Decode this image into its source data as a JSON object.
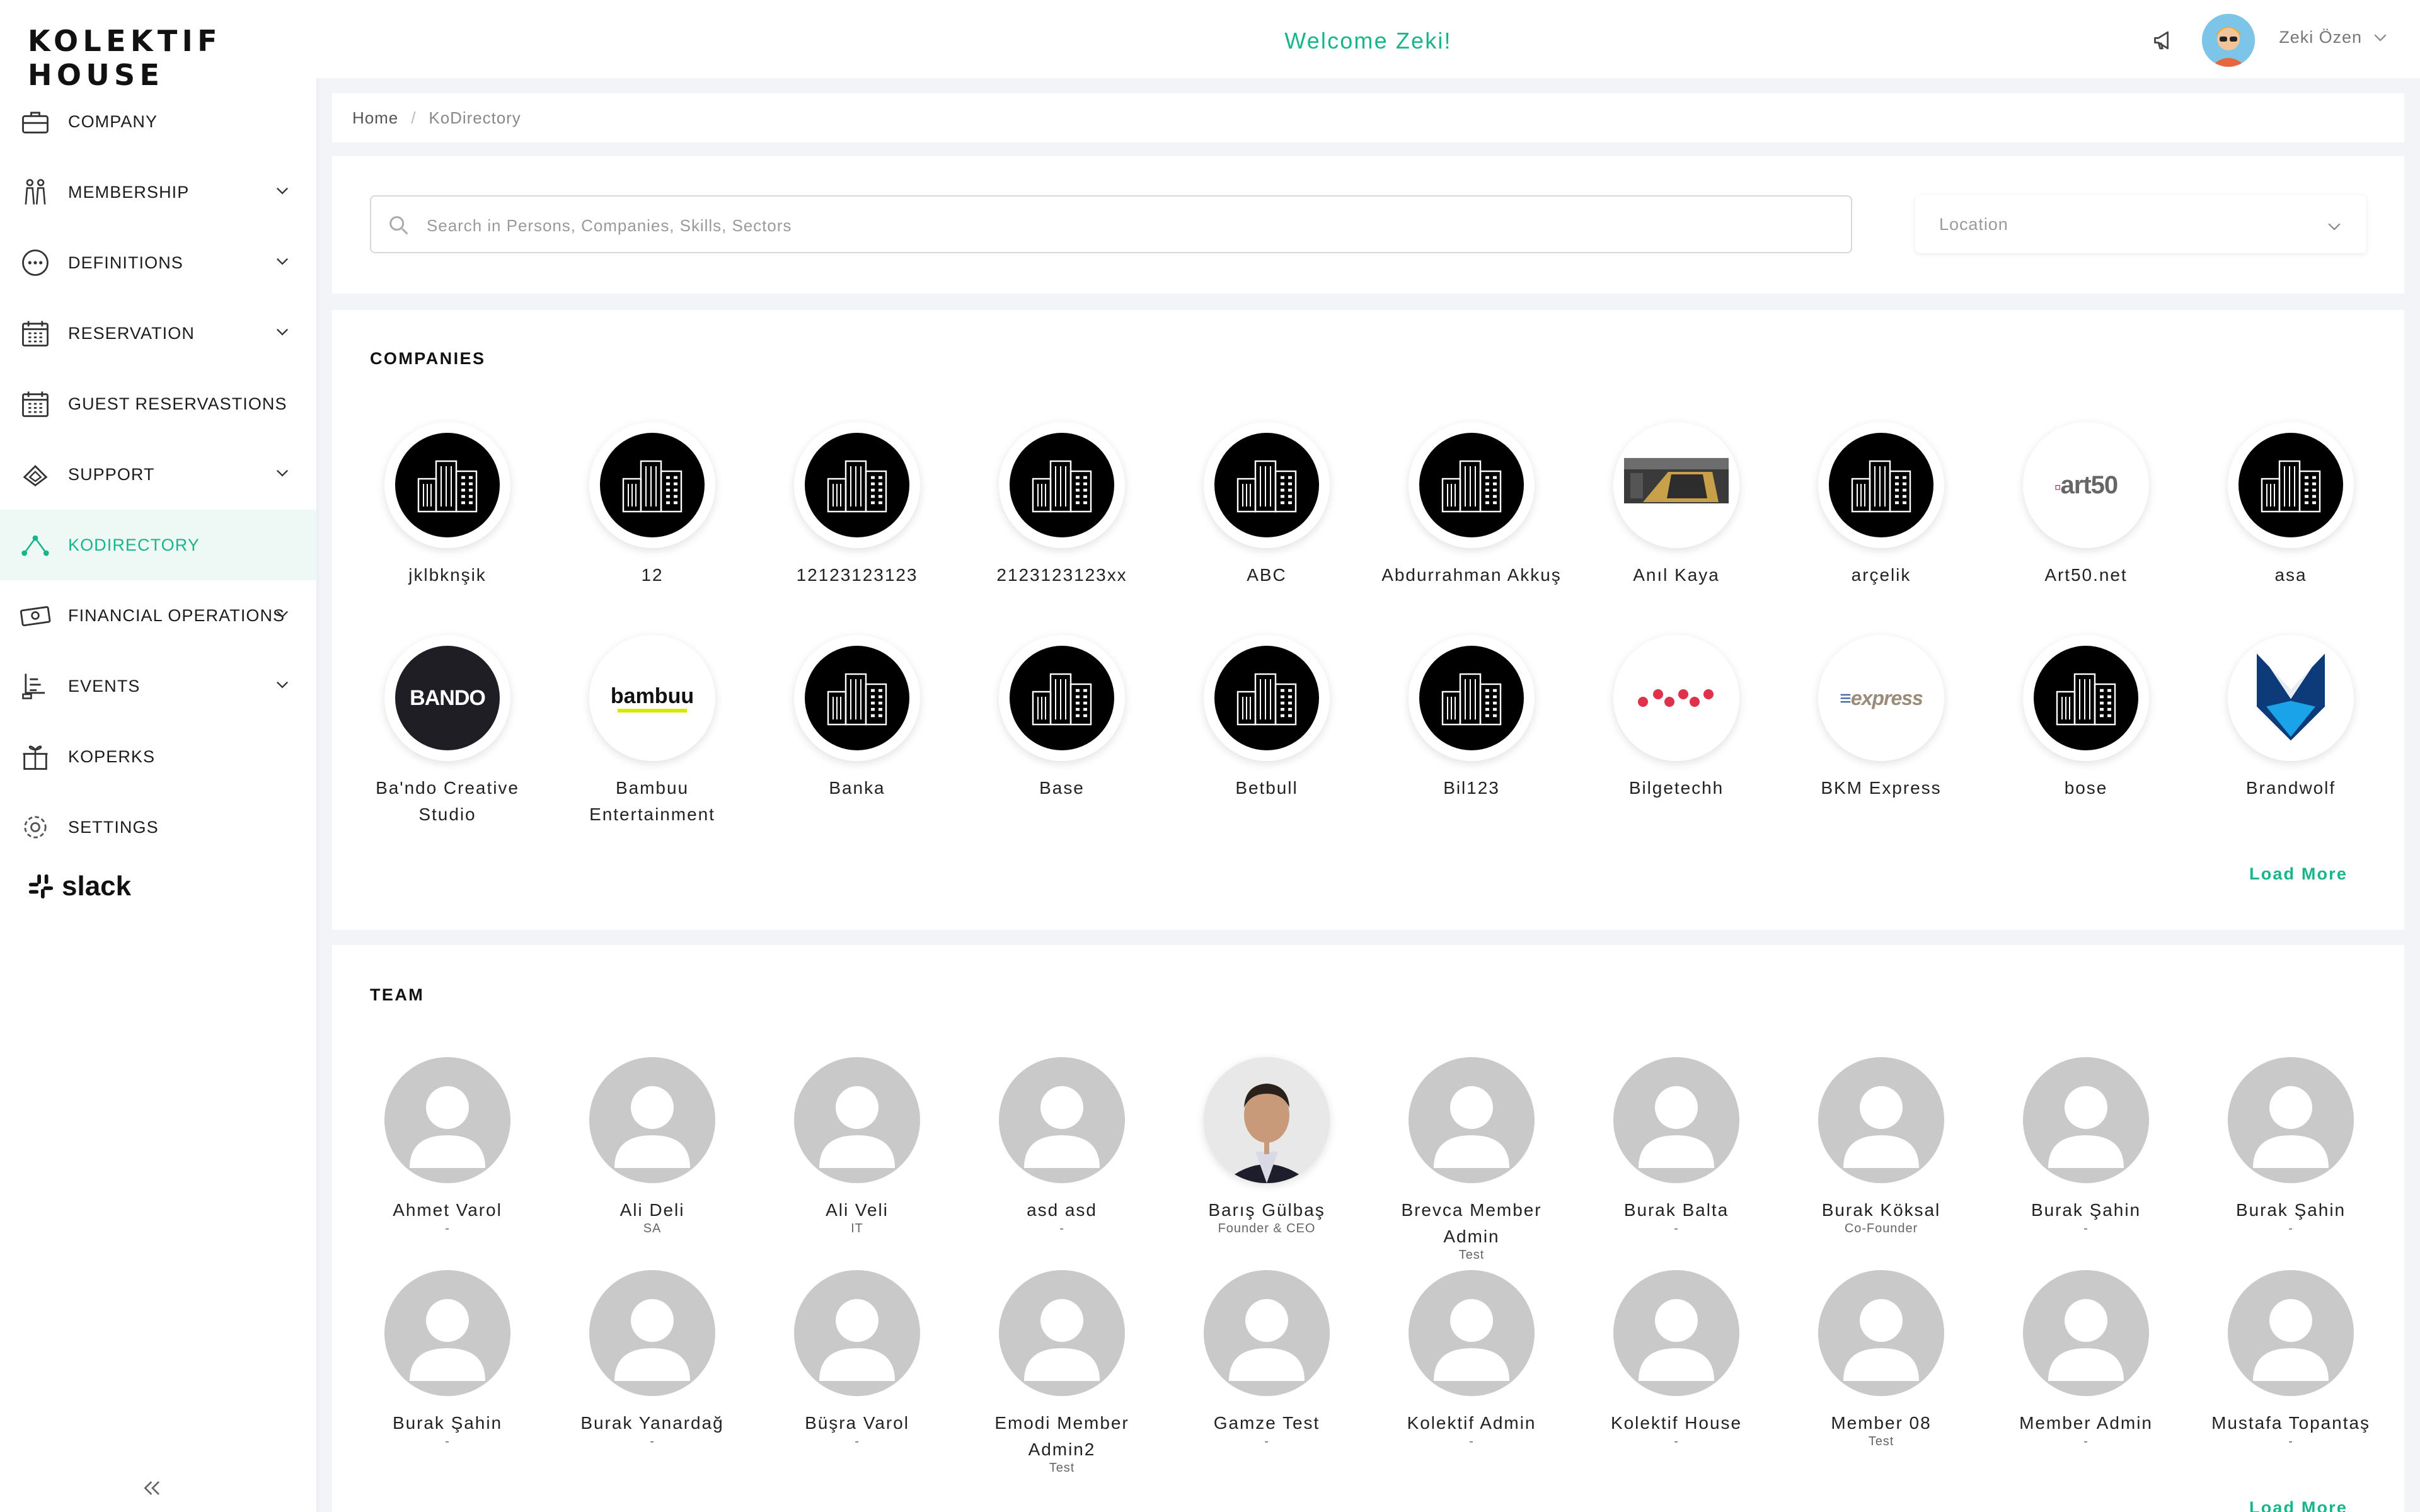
{
  "app": {
    "logo": "KOLEKTIF HOUSE"
  },
  "header": {
    "welcome": "Welcome Zeki!",
    "user_name": "Zeki Özen"
  },
  "sidebar": {
    "items": [
      {
        "label": "COMPANY",
        "icon": "briefcase-icon",
        "expandable": false,
        "active": false
      },
      {
        "label": "MEMBERSHIP",
        "icon": "people-icon",
        "expandable": true,
        "active": false
      },
      {
        "label": "DEFINITIONS",
        "icon": "dots-circle-icon",
        "expandable": true,
        "active": false
      },
      {
        "label": "RESERVATION",
        "icon": "calendar-icon",
        "expandable": true,
        "active": false
      },
      {
        "label": "GUEST RESERVASTIONS",
        "icon": "calendar-icon",
        "expandable": false,
        "active": false
      },
      {
        "label": "SUPPORT",
        "icon": "support-icon",
        "expandable": true,
        "active": false
      },
      {
        "label": "KODIRECTORY",
        "icon": "network-icon",
        "expandable": false,
        "active": true
      },
      {
        "label": "FINANCIAL OPERATIONS",
        "icon": "cash-icon",
        "expandable": true,
        "active": false
      },
      {
        "label": "EVENTS",
        "icon": "events-icon",
        "expandable": true,
        "active": false
      },
      {
        "label": "KOPERKS",
        "icon": "gift-icon",
        "expandable": false,
        "active": false
      },
      {
        "label": "SETTINGS",
        "icon": "gear-icon",
        "expandable": false,
        "active": false
      }
    ],
    "slack_label": "slack"
  },
  "breadcrumb": {
    "home": "Home",
    "current": "KoDirectory"
  },
  "search": {
    "placeholder": "Search in Persons, Companies, Skills, Sectors",
    "location_placeholder": "Location"
  },
  "companies": {
    "title": "COMPANIES",
    "load_more": "Load More",
    "items": [
      {
        "name": "jklbknşik",
        "logo": "building"
      },
      {
        "name": "12",
        "logo": "building"
      },
      {
        "name": "12123123123",
        "logo": "building"
      },
      {
        "name": "2123123123xx",
        "logo": "building"
      },
      {
        "name": "ABC",
        "logo": "building"
      },
      {
        "name": "Abdurrahman Akkuş",
        "logo": "building"
      },
      {
        "name": "Anıl Kaya",
        "logo": "photo"
      },
      {
        "name": "arçelik",
        "logo": "building"
      },
      {
        "name": "Art50.net",
        "logo": "art50",
        "logo_text": "art50"
      },
      {
        "name": "asa",
        "logo": "building"
      },
      {
        "name": "Ba'ndo Creative Studio",
        "logo": "bando",
        "logo_text": "BANDO"
      },
      {
        "name": "Bambuu Entertainment",
        "logo": "bambuu",
        "logo_text": "bambuu"
      },
      {
        "name": "Banka",
        "logo": "building"
      },
      {
        "name": "Base",
        "logo": "building"
      },
      {
        "name": "Betbull",
        "logo": "building"
      },
      {
        "name": "Bil123",
        "logo": "building"
      },
      {
        "name": "Bilgetechh",
        "logo": "dots"
      },
      {
        "name": "BKM Express",
        "logo": "bkm",
        "logo_text": "express"
      },
      {
        "name": "bose",
        "logo": "building"
      },
      {
        "name": "Brandwolf",
        "logo": "brandwolf"
      }
    ]
  },
  "team": {
    "title": "TEAM",
    "load_more": "Load More",
    "members": [
      {
        "name": "Ahmet Varol",
        "role": "-",
        "photo": false
      },
      {
        "name": "Ali Deli",
        "role": "SA",
        "photo": false
      },
      {
        "name": "Ali Veli",
        "role": "IT",
        "photo": false
      },
      {
        "name": "asd asd",
        "role": "-",
        "photo": false
      },
      {
        "name": "Barış Gülbaş",
        "role": "Founder & CEO",
        "photo": true
      },
      {
        "name": "Brevca Member Admin",
        "role": "Test",
        "photo": false
      },
      {
        "name": "Burak Balta",
        "role": "-",
        "photo": false
      },
      {
        "name": "Burak Köksal",
        "role": "Co-Founder",
        "photo": false
      },
      {
        "name": "Burak Şahin",
        "role": "-",
        "photo": false
      },
      {
        "name": "Burak Şahin",
        "role": "-",
        "photo": false
      },
      {
        "name": "Burak Şahin",
        "role": "-",
        "photo": false
      },
      {
        "name": "Burak Yanardağ",
        "role": "-",
        "photo": false
      },
      {
        "name": "Büşra Varol",
        "role": "-",
        "photo": false
      },
      {
        "name": "Emodi Member Admin2",
        "role": "Test",
        "photo": false
      },
      {
        "name": "Gamze Test",
        "role": "-",
        "photo": false
      },
      {
        "name": "Kolektif Admin",
        "role": "-",
        "photo": false
      },
      {
        "name": "Kolektif House",
        "role": "-",
        "photo": false
      },
      {
        "name": "Member 08",
        "role": "Test",
        "photo": false
      },
      {
        "name": "Member Admin",
        "role": "-",
        "photo": false
      },
      {
        "name": "Mustafa Topantaş",
        "role": "-",
        "photo": false
      }
    ]
  },
  "colors": {
    "accent": "#17b58a",
    "active_bg": "#eef9f6",
    "placeholder_avatar": "#c9c9c9"
  }
}
